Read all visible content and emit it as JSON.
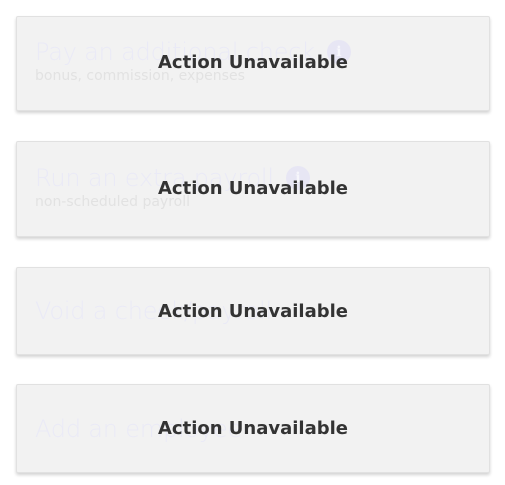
{
  "cards": [
    {
      "title": "Pay an additional check",
      "subtitle": "bonus, commission, expenses",
      "info_icon": "info-icon",
      "overlay_label": "Action Unavailable"
    },
    {
      "title": "Run an extra payroll",
      "subtitle": "non-scheduled payroll",
      "info_icon": "info-icon",
      "overlay_label": "Action Unavailable"
    },
    {
      "title": "Void a check/payroll",
      "overlay_label": "Action Unavailable"
    },
    {
      "title": "Add an employee",
      "overlay_label": "Action Unavailable"
    }
  ]
}
